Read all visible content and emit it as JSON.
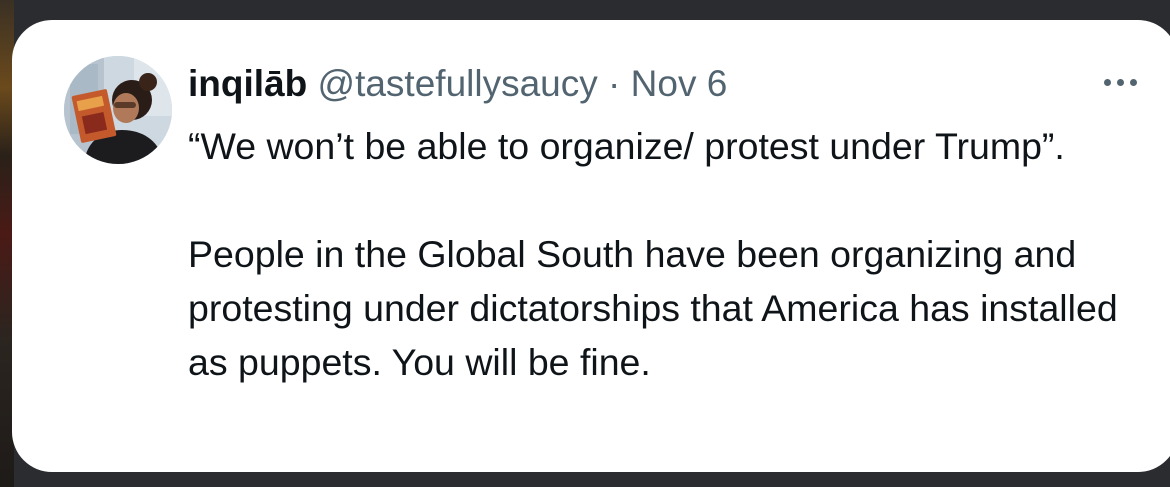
{
  "tweet": {
    "display_name": "inqilāb",
    "handle": "@tastefullysaucy",
    "separator": "·",
    "date": "Nov 6",
    "paragraph_1": "“We won’t be able to organize/ protest under Trump”.",
    "paragraph_2": "People in the Global South have been organizing and protesting under dictatorships that America has installed as puppets. You will be fine."
  },
  "icons": {
    "more": "more-horizontal-icon"
  },
  "colors": {
    "background": "#2a2c30",
    "card": "#ffffff",
    "text_primary": "#0f1419",
    "text_secondary": "#536471"
  }
}
